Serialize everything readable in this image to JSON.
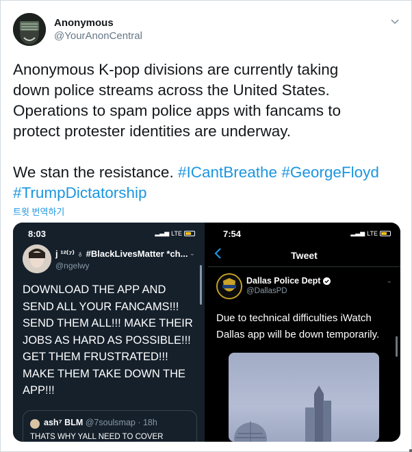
{
  "tweet": {
    "author_name": "Anonymous",
    "author_handle": "@YourAnonCentral",
    "text_line1": "Anonymous K-pop divisions are currently taking",
    "text_line2": "down police streams across the United States.",
    "text_line3": "Operations to spam police apps with fancams to",
    "text_line4": "protect protester identities are underway.",
    "text_line6_prefix": "We stan the resistance.",
    "hashtags": [
      "#ICantBreathe",
      "#GeorgeFloyd",
      "#TrumpDictatorship"
    ],
    "translate_label": "트윗 번역하기",
    "menu_icon": "chevron-down-icon"
  },
  "left_screenshot": {
    "status_time": "8:03",
    "status_network": "LTE",
    "author_name": "j ¹²⁽⁷⁾ ♁ #BlackLivesMatter *ch...",
    "author_handle": "@ngelwy",
    "body": "DOWNLOAD THE APP AND\nSEND ALL YOUR FANCAMS!!!\nSEND THEM ALL!!! MAKE THEIR\nJOBS AS HARD AS POSSIBLE!!!\nGET THEM FRUSTRATED!!!\nMAKE THEM TAKE DOWN THE\nAPP!!!",
    "quote": {
      "name": "ash⁷ BLM",
      "handle_time": "@7soulsmap · 18h",
      "text": "THATS WHY YALL NEED TO COVER"
    }
  },
  "right_screenshot": {
    "status_time": "7:54",
    "status_network": "LTE",
    "title": "Tweet",
    "author_name": "Dallas Police Dept",
    "author_handle": "@DallasPD",
    "body": "Due to technical difficulties iWatch\nDallas app will be down temporarily.",
    "verified_icon": "verified-badge-icon"
  },
  "colors": {
    "hashtag": "#1b95e0",
    "dark_bg": "#15202b",
    "black_bg": "#000000"
  }
}
